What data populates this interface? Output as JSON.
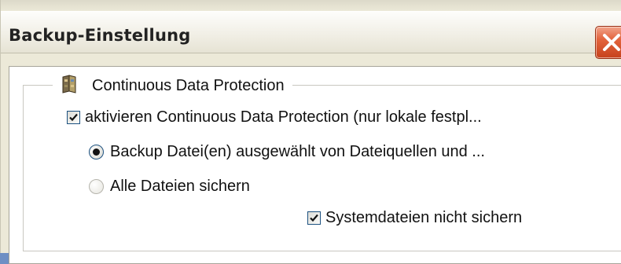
{
  "window": {
    "title": "Backup-Einstellung",
    "close_icon": "close-icon"
  },
  "cdp_group": {
    "legend": "Continuous Data Protection",
    "legend_icon": "cdp-icon",
    "enable_checkbox": {
      "label": "aktivieren Continuous Data Protection (nur lokale festpl...",
      "checked": true
    },
    "radio_selected_sources": {
      "label": "Backup Datei(en) ausgewählt von Dateiquellen und ...",
      "selected": true
    },
    "radio_all_files": {
      "label": "Alle Dateien sichern",
      "selected": false
    },
    "skip_system_files": {
      "label": "Systemdateien nicht sichern",
      "checked": true
    }
  },
  "colors": {
    "dialog_bg": "#ece9d8",
    "close_button": "#e3643d",
    "control_border": "#1c5180"
  }
}
